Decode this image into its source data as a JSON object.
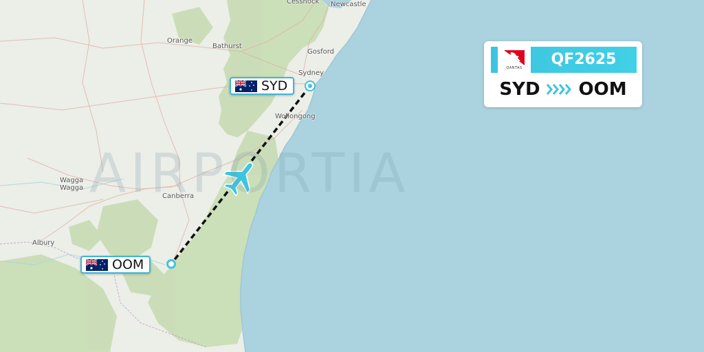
{
  "flight": {
    "number": "QF2625",
    "airline_logo": "qantas-kangaroo-logo",
    "origin": "SYD",
    "destination": "OOM",
    "route_arrow_icon": "chevrons-right-icon"
  },
  "map": {
    "watermark": "AIRPORTIA",
    "places": [
      "Cessnock",
      "Newcastle",
      "Orange",
      "Bathurst",
      "Gosford",
      "Sydney",
      "Wollongong",
      "Wagga",
      "Wagga",
      "Canberra",
      "Albury"
    ],
    "colors": {
      "sea": "#aad3df",
      "land": "#eaeee6",
      "forest": "#c6dcb2",
      "route": "#111111",
      "accent": "#3ec4e0"
    }
  },
  "airports": {
    "origin": {
      "code": "SYD",
      "flag_icon": "australia-flag-icon"
    },
    "destination": {
      "code": "OOM",
      "flag_icon": "australia-flag-icon"
    }
  },
  "aircraft_icon": "airplane-icon"
}
